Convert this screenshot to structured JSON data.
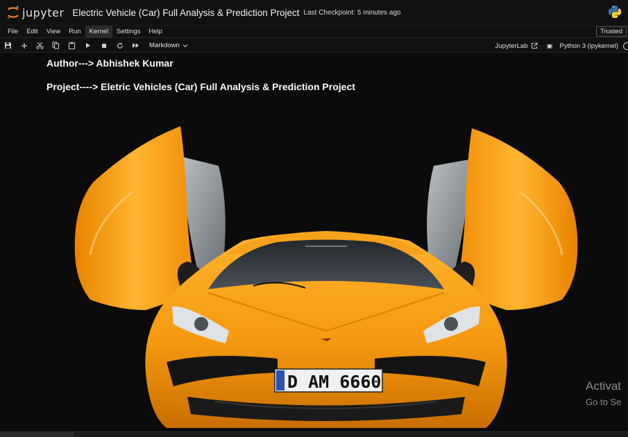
{
  "app": {
    "logo_text": "jupyter"
  },
  "notebook": {
    "title": "Electric Vehicle (Car) Full Analysis & Prediction Project",
    "checkpoint": "Last Checkpoint: 5 minutes ago"
  },
  "menu": {
    "items": [
      "File",
      "Edit",
      "View",
      "Run",
      "Kernel",
      "Settings",
      "Help"
    ],
    "active": "Kernel",
    "trusted": "Trusted"
  },
  "toolbar": {
    "cell_type": "Markdown",
    "jupyterlab_link": "JupyterLab",
    "kernel_name": "Python 3 (ipykernel)"
  },
  "cell": {
    "author_line": "Author---> Abhishek Kumar",
    "project_line": "Project----> Eletric Vehicles (Car) Full Analysis & Prediction Project",
    "license_plate": "D AM 6660"
  },
  "os_overlay": {
    "activate": "Activat",
    "go_to": "Go to Se"
  },
  "colors": {
    "car_orange": "#f59a10",
    "background": "#0b0b0b",
    "header": "#111111"
  }
}
